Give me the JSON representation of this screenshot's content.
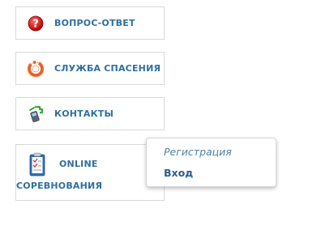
{
  "menu": {
    "faq": {
      "label": "ВОПРОС-ОТВЕТ",
      "icon": "question-icon"
    },
    "rescue": {
      "label": "СЛУЖБА СПАСЕНИЯ",
      "icon": "lifebuoy-icon"
    },
    "contacts": {
      "label": "КОНТАКТЫ",
      "icon": "phone-icon"
    },
    "online": {
      "label_line1": "ONLINE",
      "label_line2": "СОРЕВНОВАНИЯ",
      "icon": "clipboard-icon"
    }
  },
  "popup": {
    "register_label": "Регистрация",
    "login_label": "Вход"
  },
  "colors": {
    "label": "#2f6f9f",
    "border": "#d9d9d9"
  }
}
